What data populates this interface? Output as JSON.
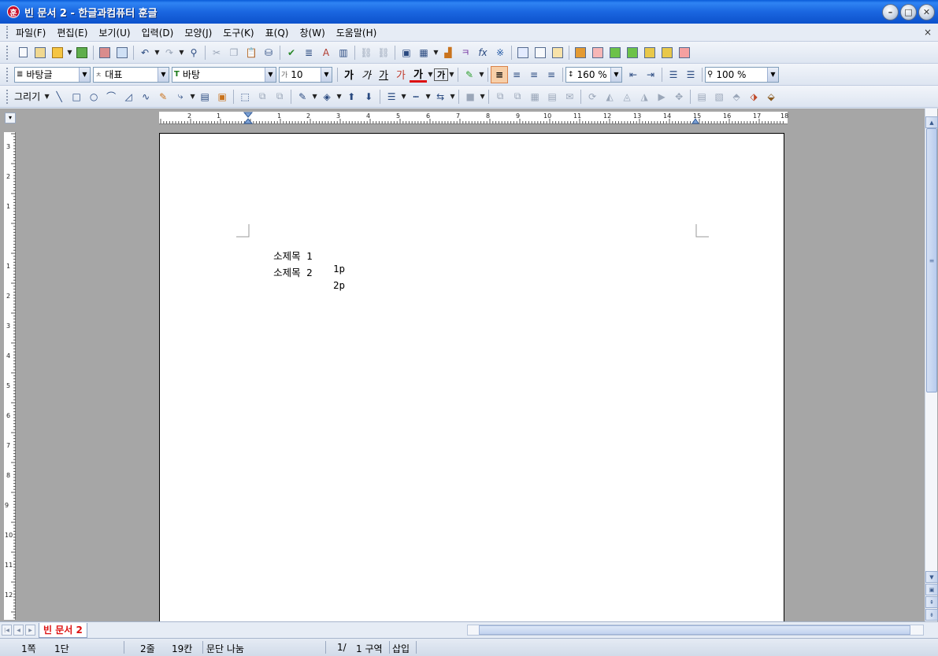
{
  "window": {
    "title": "빈 문서 2 - 한글과컴퓨터 훈글",
    "app_icon_glyph": "훈",
    "controls": [
      "minimize",
      "maximize",
      "close"
    ]
  },
  "menu": {
    "items": [
      "파일(F)",
      "편집(E)",
      "보기(U)",
      "입력(D)",
      "모양(J)",
      "도구(K)",
      "표(Q)",
      "창(W)",
      "도움말(H)"
    ],
    "close_glyph": "×"
  },
  "format_bar": {
    "style_value": "바탕글",
    "language_value": "대표",
    "font_value": "바탕",
    "size_value": "10",
    "bold": "가",
    "italic": "가",
    "underline": "가",
    "strike": "가",
    "char_color": "가",
    "shade": "가",
    "line_spacing_value": "160 %",
    "zoom_value": "100 %"
  },
  "draw_bar": {
    "label": "그리기"
  },
  "ruler": {
    "h_ticks": [
      "2",
      "1",
      "1",
      "2",
      "3",
      "4",
      "5",
      "6",
      "7",
      "8",
      "9",
      "10",
      "11",
      "12",
      "13",
      "14",
      "15",
      "16",
      "17",
      "18"
    ],
    "v_ticks": [
      "3",
      "2",
      "1",
      "1",
      "2",
      "3",
      "4",
      "5",
      "6",
      "7",
      "8",
      "9",
      "10",
      "11",
      "12"
    ]
  },
  "document": {
    "lines": [
      {
        "title": "소제목 1",
        "page": "1p"
      },
      {
        "title": "소제목 2",
        "page": "2p"
      }
    ]
  },
  "tabs": {
    "active_tab": "빈 문서 2"
  },
  "status": {
    "page": "1쪽",
    "column": "1단",
    "line": "2줄",
    "char": "19칸",
    "paragraph_break": "문단 나눔",
    "page_of": "1/",
    "section": "1 구역",
    "mode": "삽입"
  },
  "colors": {
    "title_bar": "#1a66e0",
    "workspace": "#a6a6a6",
    "active_tab_text": "#dd1111"
  }
}
